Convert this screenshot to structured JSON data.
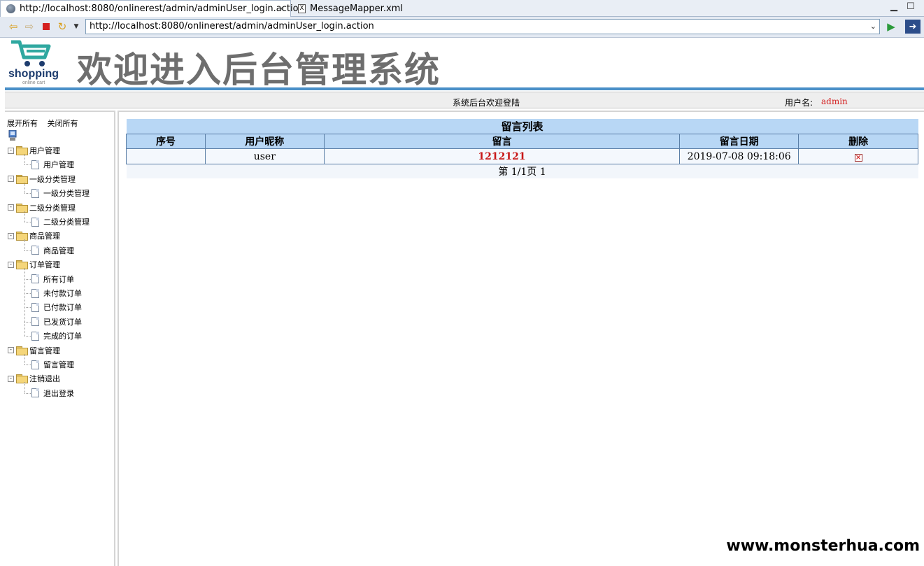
{
  "browser": {
    "active_tab": "http://localhost:8080/onlinerest/admin/adminUser_login.action",
    "inactive_tab": "MessageMapper.xml",
    "url": "http://localhost:8080/onlinerest/admin/adminUser_login.action"
  },
  "header": {
    "logo_text": "shopping",
    "logo_subtext": "online cart",
    "banner_title": "欢迎进入后台管理系统",
    "welcome": "系统后台欢迎登陆",
    "user_label": "用户名:",
    "user_name": "admin"
  },
  "sidebar": {
    "expand_all": "展开所有",
    "collapse_all": "关闭所有",
    "groups": [
      {
        "label": "用户管理",
        "children": [
          "用户管理"
        ]
      },
      {
        "label": "一级分类管理",
        "children": [
          "一级分类管理"
        ]
      },
      {
        "label": "二级分类管理",
        "children": [
          "二级分类管理"
        ]
      },
      {
        "label": "商品管理",
        "children": [
          "商品管理"
        ]
      },
      {
        "label": "订单管理",
        "children": [
          "所有订单",
          "未付款订单",
          "已付款订单",
          "已发货订单",
          "完成的订单"
        ]
      },
      {
        "label": "留言管理",
        "children": [
          "留言管理"
        ]
      },
      {
        "label": "注销退出",
        "children": [
          "退出登录"
        ]
      }
    ]
  },
  "table": {
    "caption": "留言列表",
    "headers": [
      "序号",
      "用户昵称",
      "留言",
      "留言日期",
      "删除"
    ],
    "rows": [
      {
        "index": "",
        "nickname": "user",
        "content": "1212121",
        "date": "2019-07-08 09:18:06"
      }
    ],
    "pager": "第 1/1页 1"
  },
  "watermark": "www.monsterhua.com",
  "colors": {
    "accent_blue": "#4a90c8",
    "table_header": "#b8d7f5",
    "highlight_red": "#c81818"
  }
}
